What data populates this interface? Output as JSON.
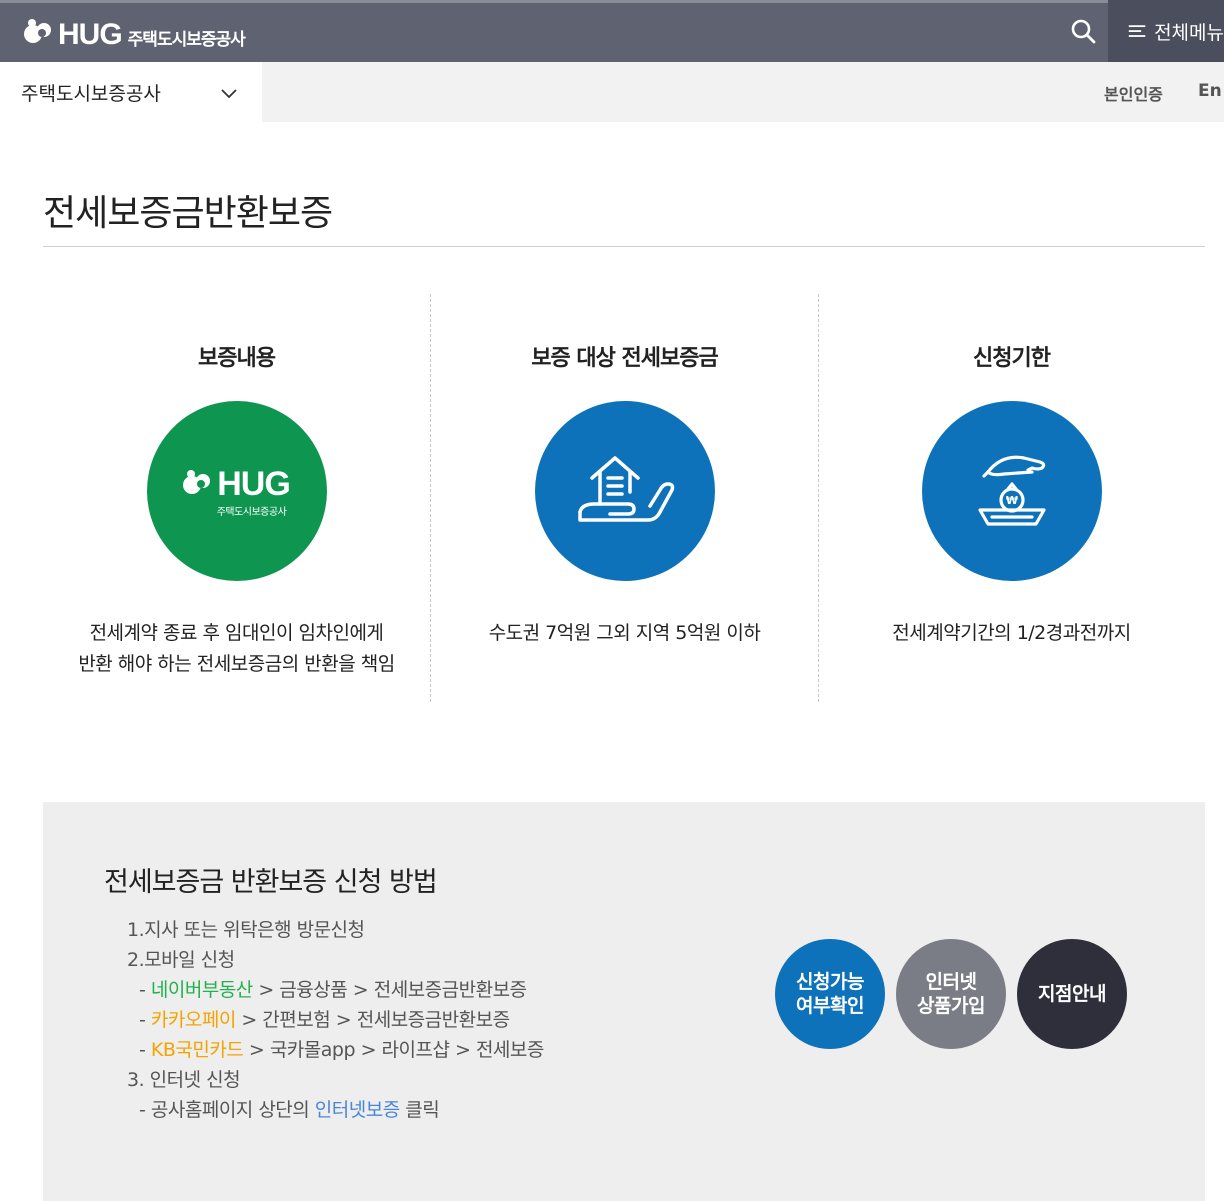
{
  "header": {
    "logo_text": "HUG",
    "logo_subtext": "주택도시보증공사",
    "search_icon": "search-icon",
    "menu_label": "전체메뉴"
  },
  "subnav": {
    "site_select_label": "주택도시보증공사",
    "auth_label": "본인인증",
    "lang_label": "En"
  },
  "page": {
    "title": "전세보증금반환보증"
  },
  "cards": [
    {
      "title": "보증내용",
      "icon": "hug-logo-icon",
      "circle_color": "#0e9650",
      "badge_text": "HUG",
      "badge_subtext": "주택도시보증공사",
      "desc_line1": "전세계약 종료 후 임대인이 임차인에게",
      "desc_line2": "반환 해야 하는 전세보증금의 반환을 책임"
    },
    {
      "title": "보증 대상 전세보증금",
      "icon": "house-in-hand-icon",
      "circle_color": "#0d72b9",
      "desc_line1": "수도권 7억원 그외 지역 5억원 이하"
    },
    {
      "title": "신청기한",
      "icon": "protected-money-bag-icon",
      "circle_color": "#0d72b9",
      "desc_line1": "전세계약기간의 1/2경과전까지"
    }
  ],
  "apply": {
    "title": "전세보증금 반환보증 신청 방법",
    "step1": "1.지사 또는 위탁은행 방문신청",
    "step2": "2.모바일 신청",
    "naver": {
      "prefix": "- ",
      "highlight": "네이버부동산",
      "rest": " > 금융상품 > 전세보증금반환보증"
    },
    "kakao": {
      "prefix": "- ",
      "highlight": "카카오페이",
      "rest": " > 간편보험 > 전세보증금반환보증"
    },
    "kb": {
      "prefix": "- ",
      "highlight": "KB국민카드",
      "rest": " > 국카몰app > 라이프샵 > 전세보증"
    },
    "step3": "3. 인터넷 신청",
    "internet": {
      "prefix": "- 공사홈페이지 상단의 ",
      "highlight": "인터넷보증",
      "rest": " 클릭"
    },
    "buttons": [
      {
        "line1": "신청가능",
        "line2": "여부확인",
        "color": "#0d72b9"
      },
      {
        "line1": "인터넷",
        "line2": "상품가입",
        "color": "#7b7d86"
      },
      {
        "line1": "지점안내",
        "line2": "",
        "color": "#2e2f3b"
      }
    ]
  }
}
